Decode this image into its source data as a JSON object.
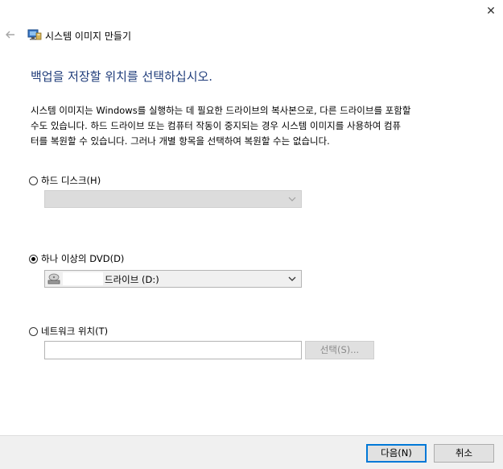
{
  "window": {
    "title": "시스템 이미지 만들기",
    "close_glyph": "✕",
    "back_icon": "back-arrow-icon",
    "app_icon": "system-image-icon"
  },
  "page": {
    "heading": "백업을 저장할 위치를 선택하십시오.",
    "description_lines": [
      "시스템 이미지는 Windows를 실행하는 데 필요한 드라이브의 복사본으로, 다른 드라이브를 포함할",
      "수도 있습니다. 하드 드라이브 또는 컴퓨터 작동이 중지되는 경우 시스템 이미지를 사용하여 컴퓨",
      "터를 복원할 수 있습니다. 그러나 개별 항목을 선택하여 복원할 수는 없습니다."
    ]
  },
  "options": {
    "hard_disk": {
      "label": "하드 디스크(H)",
      "selected": false,
      "value": ""
    },
    "dvd": {
      "label": "하나 이상의 DVD(D)",
      "selected": true,
      "value": "드라이브 (D:)"
    },
    "network": {
      "label": "네트워크 위치(T)",
      "selected": false,
      "value": "",
      "select_button": "선택(S)..."
    }
  },
  "footer": {
    "next_button": "다음(N)",
    "cancel_button": "취소"
  },
  "colors": {
    "heading": "#1f3c7a",
    "default_button_border": "#0078d7",
    "footer_bg": "#f0f0f0"
  }
}
